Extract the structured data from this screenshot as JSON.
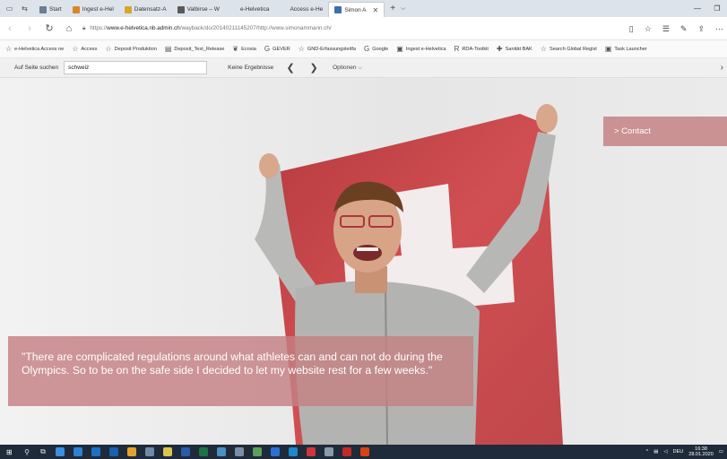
{
  "tabs": [
    {
      "label": "Start",
      "color": "#6b7c93",
      "active": false
    },
    {
      "label": "Ingest e-Hel",
      "color": "#d8862c",
      "active": false
    },
    {
      "label": "Datensatz-A",
      "color": "#d6a72b",
      "active": false
    },
    {
      "label": "Valbirse – W",
      "color": "#5a5a5a",
      "active": false
    },
    {
      "label": "e-Helvetica",
      "color": "#dde3ea",
      "active": false
    },
    {
      "label": "Access e-He",
      "color": "#dde3ea",
      "active": false
    },
    {
      "label": "Simon A",
      "color": "#3a6fb0",
      "active": true
    }
  ],
  "address": {
    "url_prefix": "https://",
    "url_domain": "www.e-helvetica.nb.admin.ch",
    "url_path": "/wayback/do/20140211145207/http://www.simonammann.ch/"
  },
  "favorites": [
    {
      "label": "e-Helvetica Access ne",
      "icon": "star-icon"
    },
    {
      "label": "Access",
      "icon": "star-icon"
    },
    {
      "label": "Deposit Produktion",
      "icon": "star-icon"
    },
    {
      "label": "Deposit_Test_Release",
      "icon": "folder-icon"
    },
    {
      "label": "Ecosia",
      "icon": "leaf-icon"
    },
    {
      "label": "GEVER",
      "icon": "g-icon"
    },
    {
      "label": "GND-Erfassungsleitfa",
      "icon": "star-icon"
    },
    {
      "label": "Google",
      "icon": "g-icon"
    },
    {
      "label": "Ingest e-Helvetica",
      "icon": "image-icon"
    },
    {
      "label": "RDA-Toolkit",
      "icon": "r-icon"
    },
    {
      "label": "Sanität BAK",
      "icon": "shield-icon"
    },
    {
      "label": "Search Global Regist",
      "icon": "star-icon"
    },
    {
      "label": "Task Launcher",
      "icon": "image-icon"
    }
  ],
  "findbar": {
    "label": "Auf Seite suchen",
    "query": "schweiz",
    "result": "Keine Ergebnisse",
    "prev_glyph": "❮",
    "next_glyph": "❯",
    "options": "Optionen ⌵",
    "close_glyph": "›"
  },
  "site": {
    "contact": "> Contact",
    "quote": "\"There are complicated regulations around what athletes can and can not do during the Olympics. So to be on the safe side I decided to let my website rest for a few weeks.\""
  },
  "taskbar": {
    "lang": "DEU",
    "time": "16:38",
    "date": "28.01.2020"
  },
  "colors": {
    "flag_red": "#c8484b",
    "overlay": "#c48082",
    "taskbar": "#1f2b3a"
  }
}
